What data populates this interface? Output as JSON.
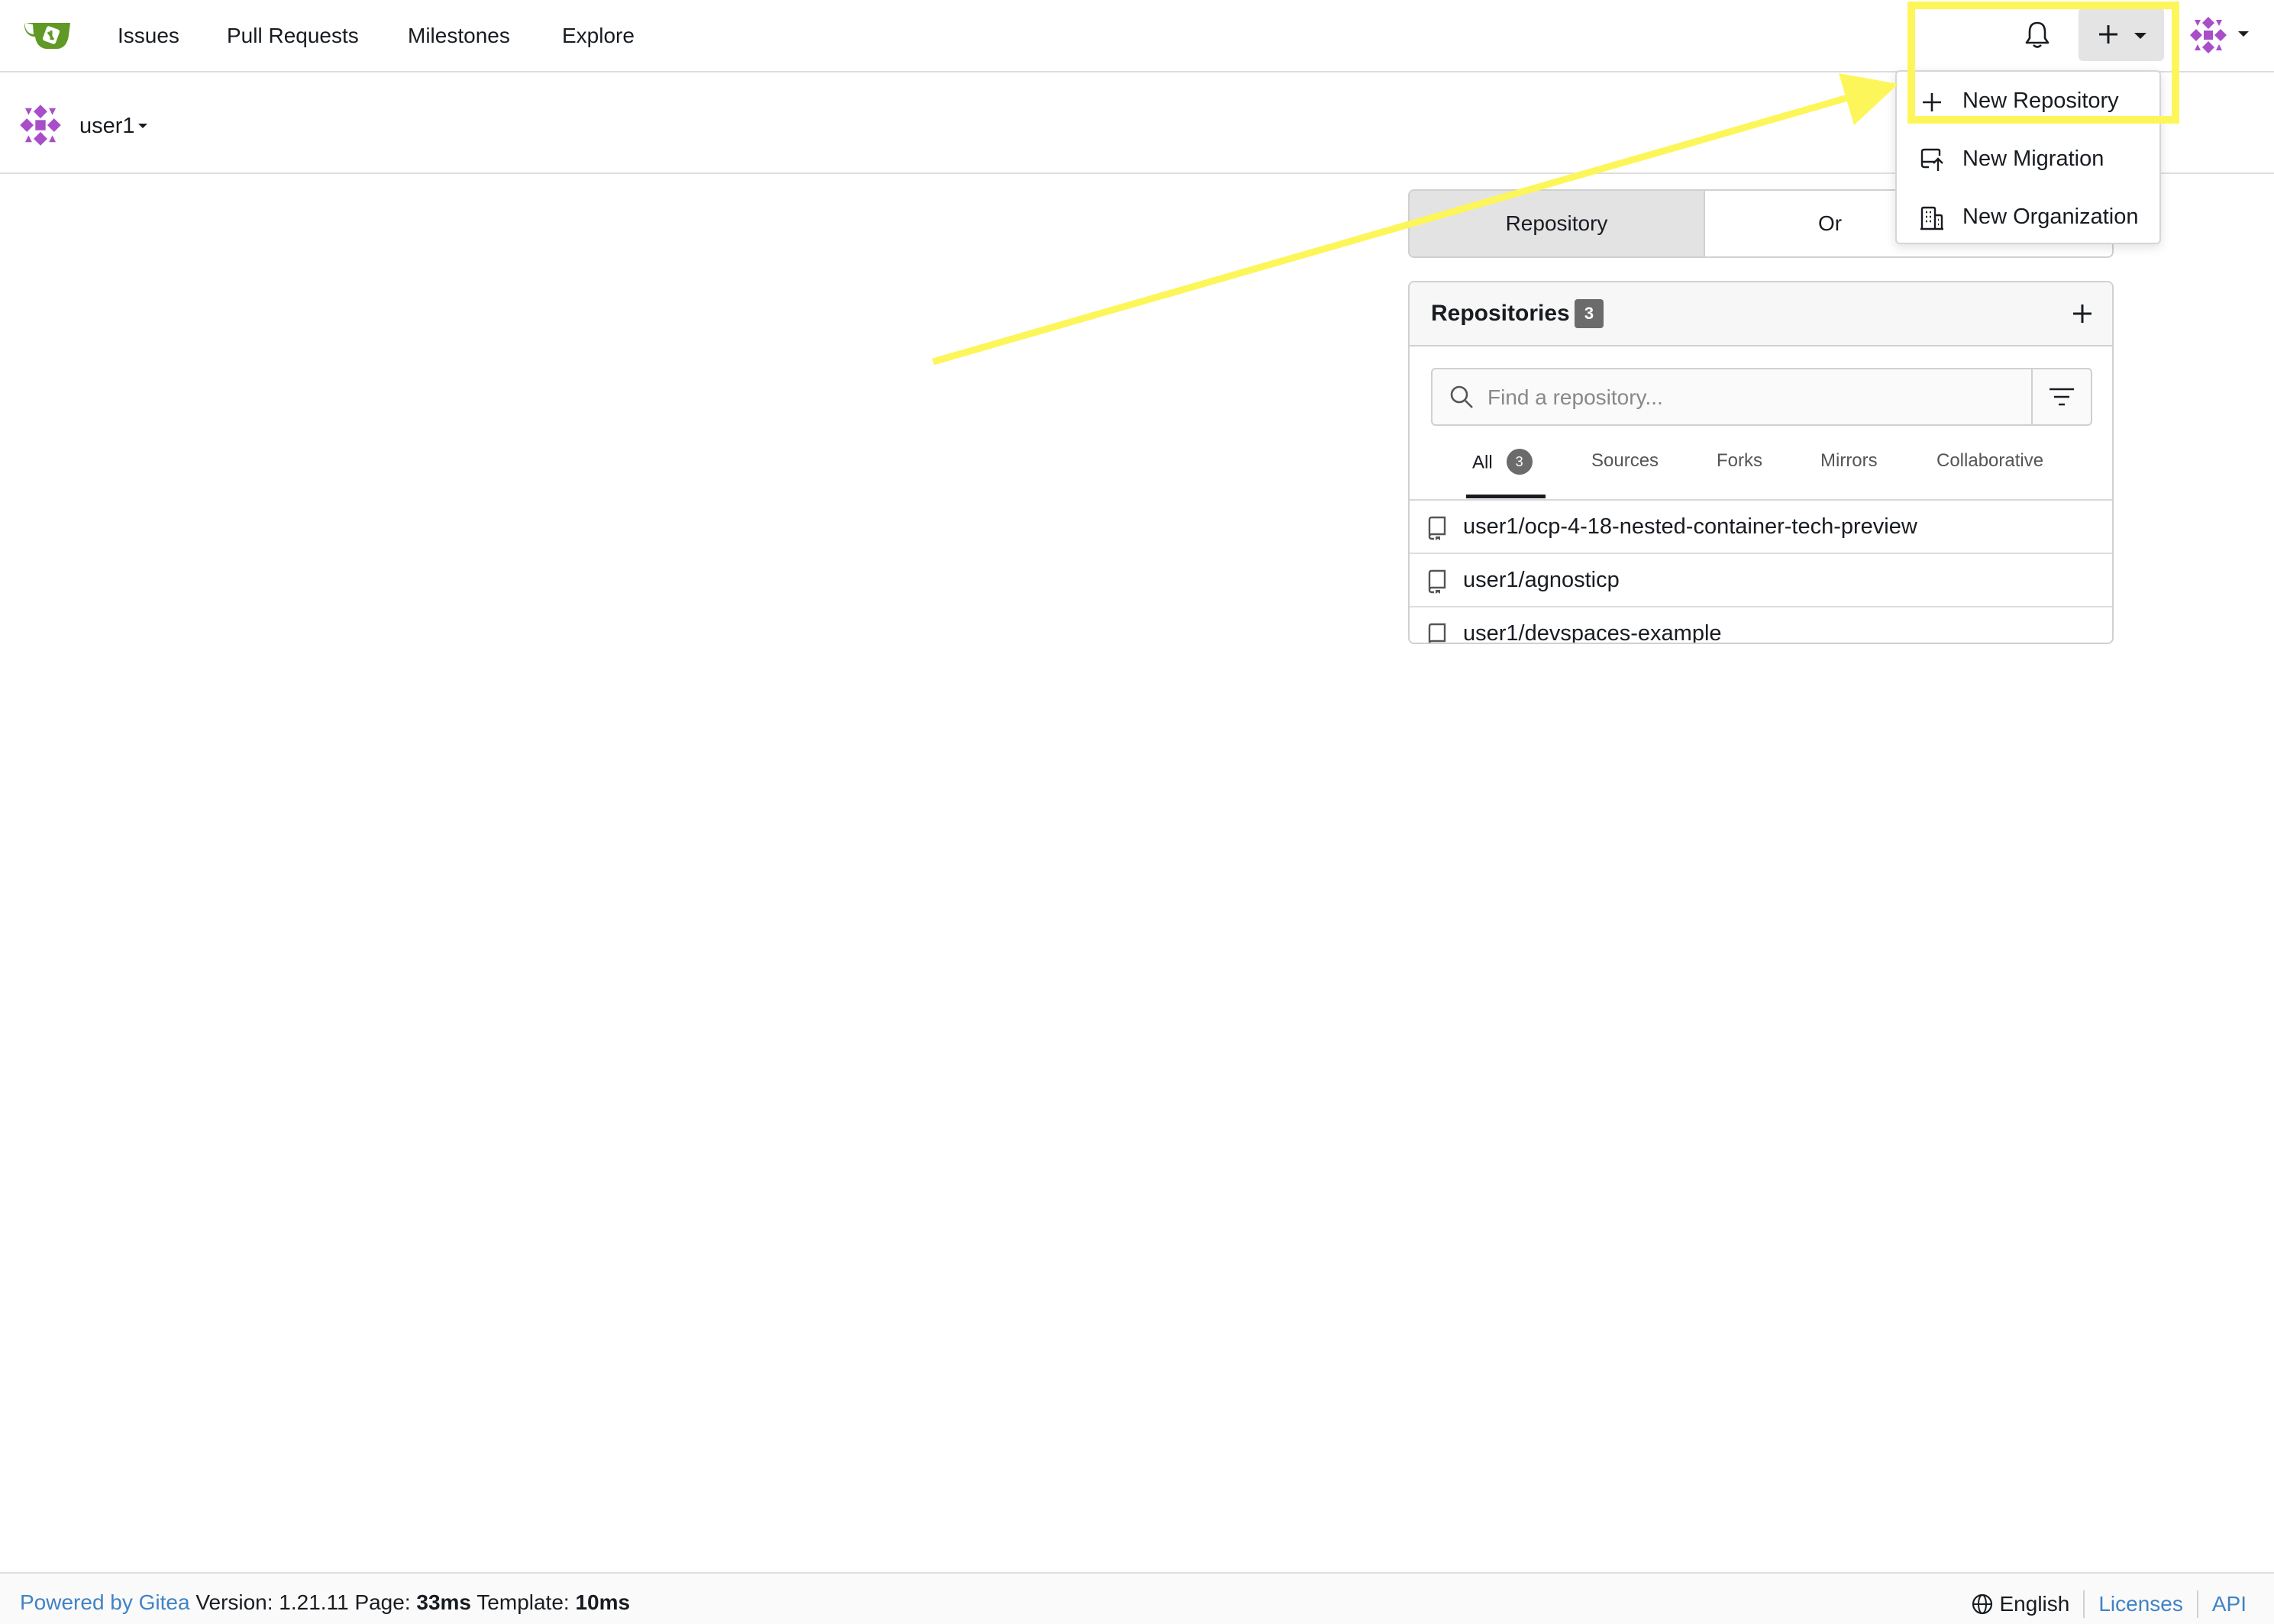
{
  "navbar": {
    "items": [
      "Issues",
      "Pull Requests",
      "Milestones",
      "Explore"
    ],
    "icons": {
      "logo": "gitea-logo",
      "notifications": "bell-icon",
      "create": "plus-icon",
      "user": "avatar"
    }
  },
  "context": {
    "user": "user1"
  },
  "dashboard_tabs": {
    "repository": "Repository",
    "organization": "Or"
  },
  "repos_panel": {
    "title": "Repositories",
    "count": "3",
    "search_placeholder": "Find a repository...",
    "filters": [
      {
        "label": "All",
        "count": "3"
      },
      {
        "label": "Sources"
      },
      {
        "label": "Forks"
      },
      {
        "label": "Mirrors"
      },
      {
        "label": "Collaborative"
      }
    ],
    "repos": [
      "user1/ocp-4-18-nested-container-tech-preview",
      "user1/agnosticp",
      "user1/devspaces-example"
    ]
  },
  "create_menu": {
    "items": [
      "New Repository",
      "New Migration",
      "New Organization"
    ]
  },
  "annotation": {
    "color": "#fdf65a"
  },
  "footer": {
    "powered_by": "Powered by Gitea",
    "version": "Version: 1.21.11",
    "page_label": "Page:",
    "page_time": "33ms",
    "template_label": "Template:",
    "template_time": "10ms",
    "language": "English",
    "licenses": "Licenses",
    "api": "API"
  },
  "colors": {
    "brand": "#609926",
    "avatar": "#a94dc9",
    "link": "#4183c4"
  }
}
